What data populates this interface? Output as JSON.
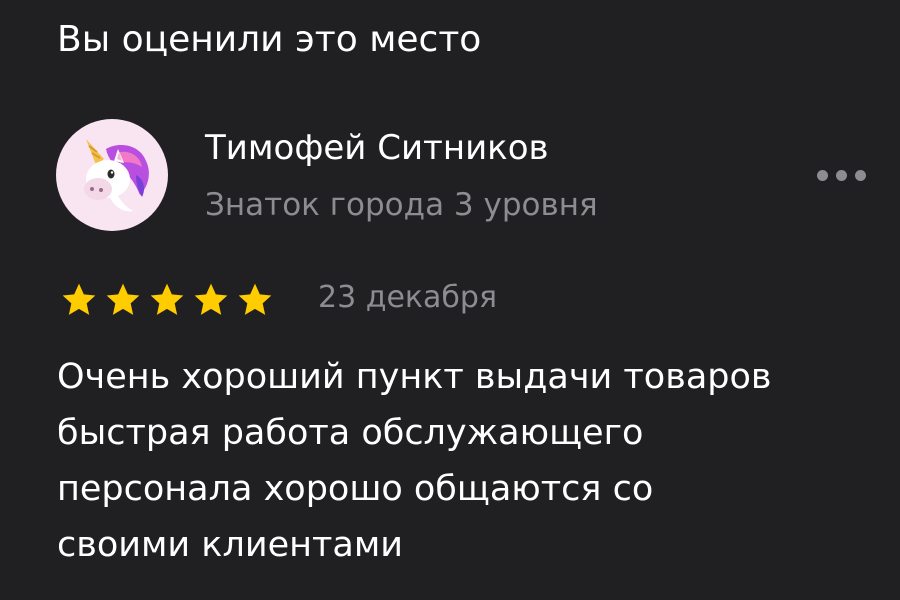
{
  "section": {
    "title": "Вы оценили это место"
  },
  "author": {
    "name": "Тимофей Ситников",
    "level": "Знаток города 3 уровня",
    "avatar_icon": "unicorn-emoji-icon",
    "avatar_background": "#f9e4f1"
  },
  "more_button_icon": "more-dots-icon",
  "rating": {
    "value": 5,
    "max": 5,
    "star_color": "#ffcc00"
  },
  "review": {
    "date": "23 декабря",
    "lines": [
      "Очень хороший пункт выдачи товаров",
      "быстрая работа обслужающего",
      "персонала хорошо общаются со",
      "своими клиентами"
    ]
  },
  "colors": {
    "background": "#202023",
    "primary_text": "#ffffff",
    "secondary_text": "#8c8c91"
  }
}
